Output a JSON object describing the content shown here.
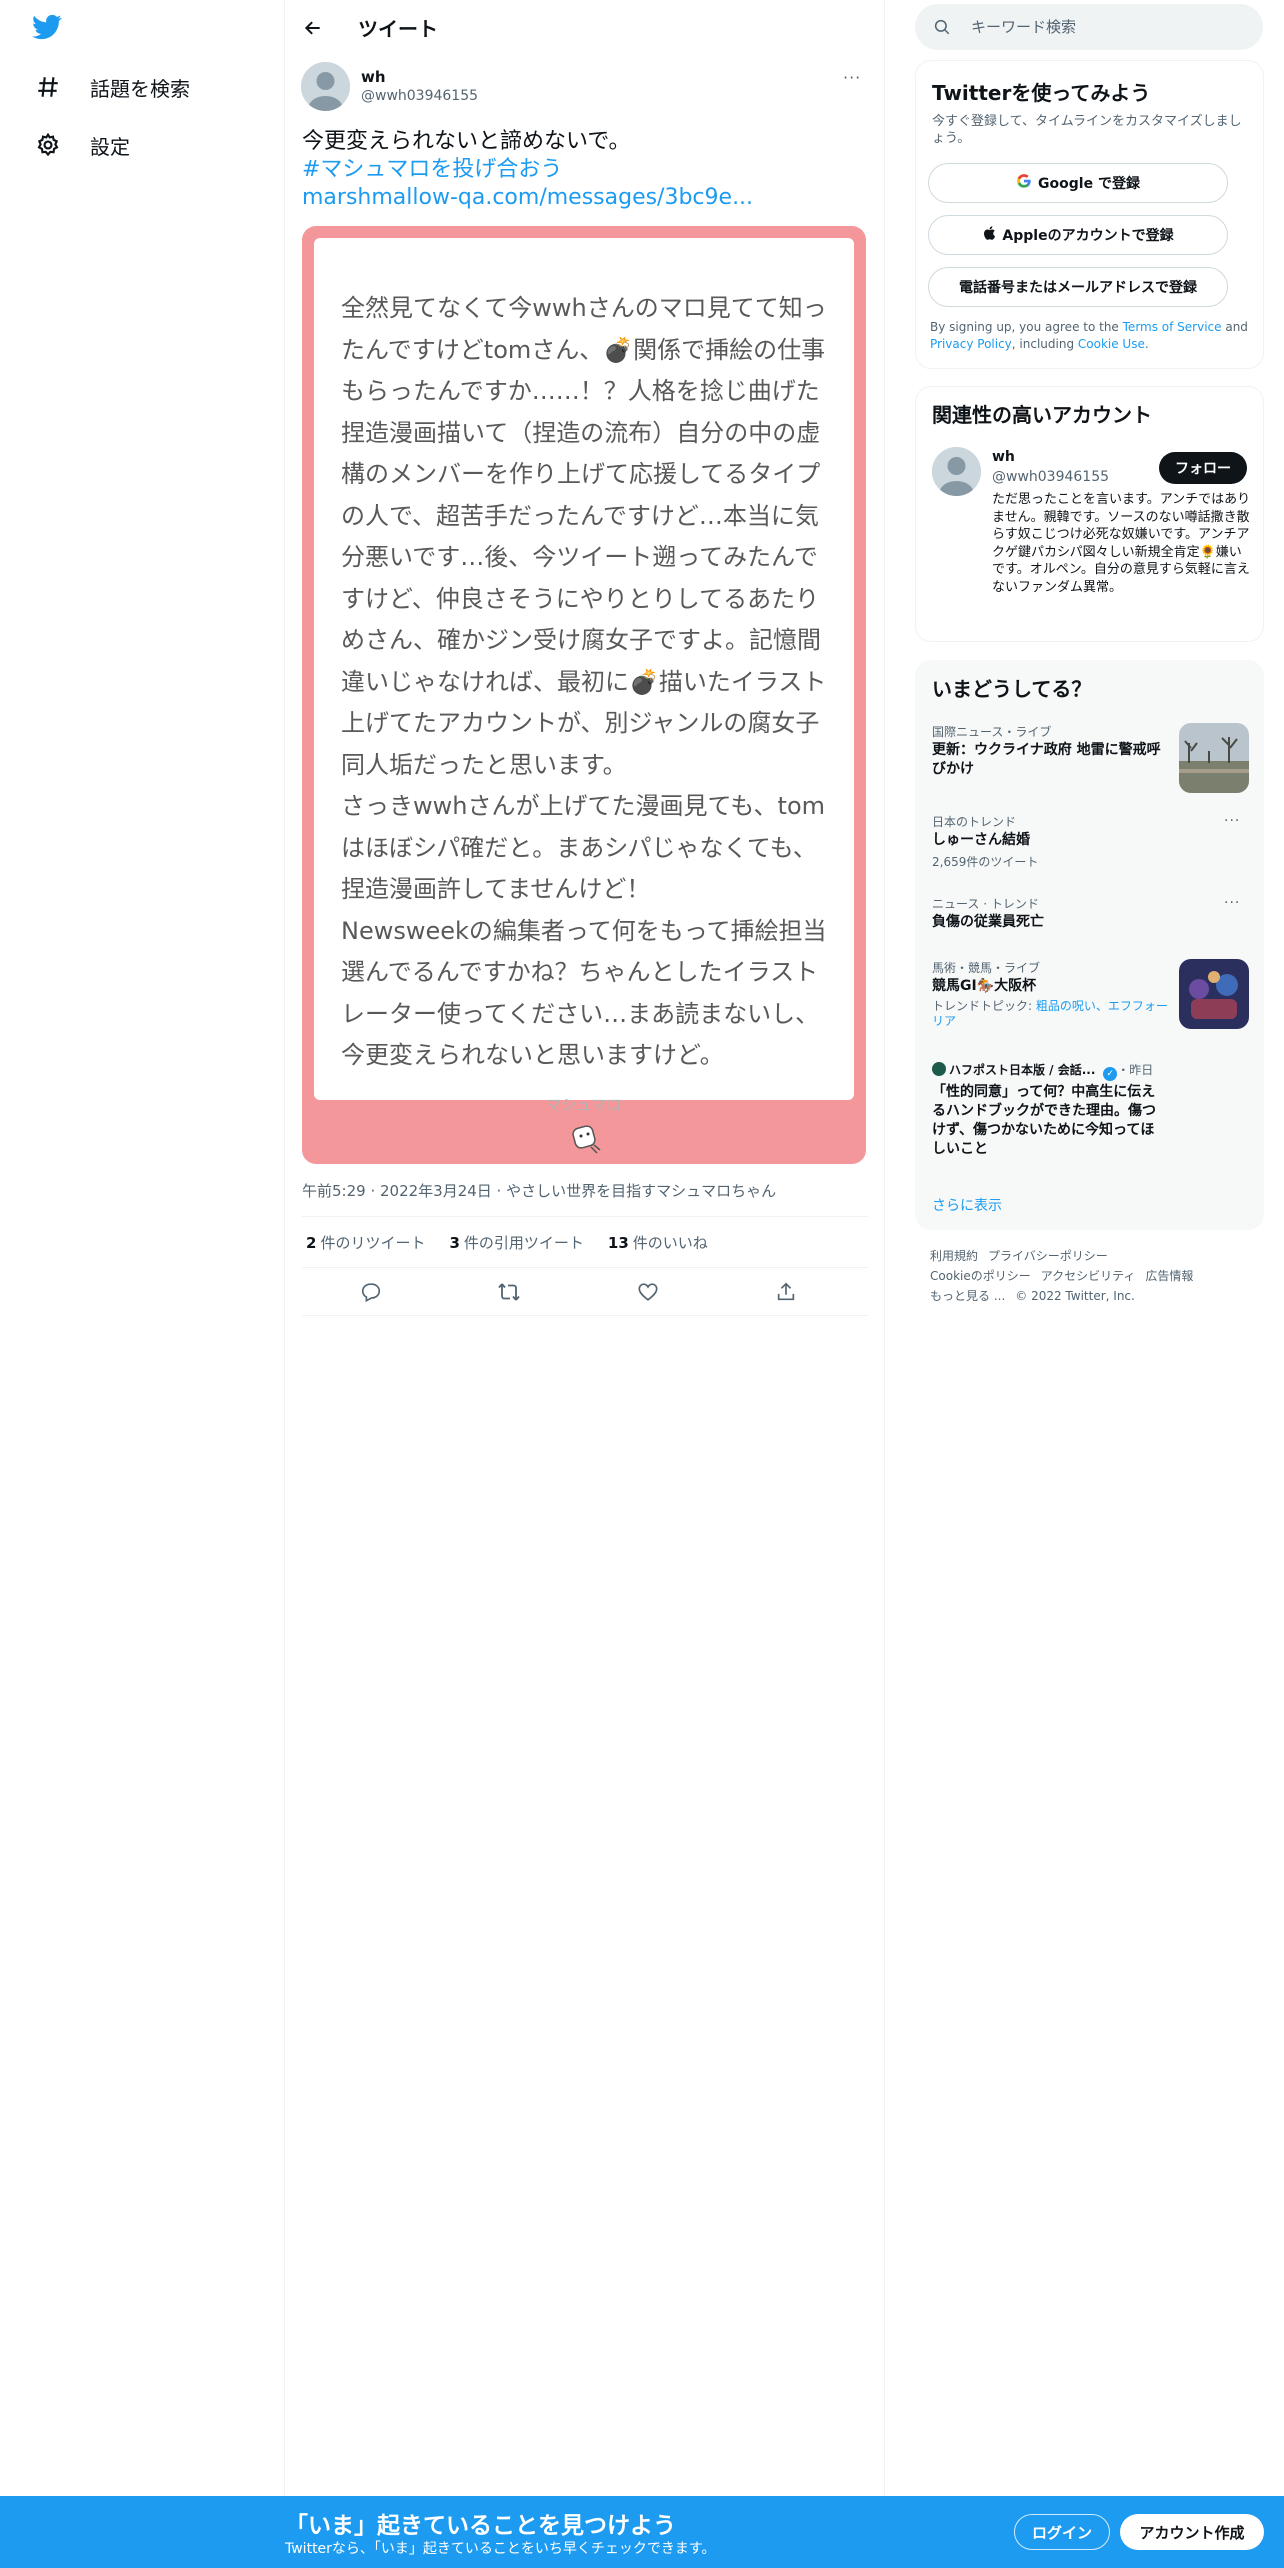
{
  "nav": {
    "items": [
      {
        "label": "話題を検索",
        "icon": "hashtag-icon"
      },
      {
        "label": "設定",
        "icon": "gear-icon"
      }
    ]
  },
  "header": {
    "title": "ツイート"
  },
  "tweet": {
    "name": "wh",
    "handle": "@wwh03946155",
    "more": "···",
    "text": "今更変えられないと諦めないで。",
    "hashtag": "#マシュマロを投げ合おう",
    "link": "marshmallow-qa.com/messages/3bc9e...",
    "card": {
      "text": "全然見てなくて今wwhさんのマロ見てて知ったんですけどtomさん、💣関係で挿絵の仕事もらったんですか……！？人格を捻じ曲げた捏造漫画描いて（捏造の流布）自分の中の虚構のメンバーを作り上げて応援してるタイプの人で、超苦手だったんですけど…本当に気分悪いです…後、今ツイート遡ってみたんですけど、仲良さそうにやりとりしてるあたりめさん、確かジン受け腐女子ですよ。記憶間違いじゃなければ、最初に💣描いたイラスト上げてたアカウントが、別ジャンルの腐女子同人垢だったと思います。\nさっきwwhさんが上げてた漫画見ても、tomはほぼシパ確だと。まあシパじゃなくても、捏造漫画許してませんけど！\nNewsweekの編集者って何をもって挿絵担当選んでるんですかね？ちゃんとしたイラストレーター使ってください…まあ読まないし、今更変えられないと思いますけど。",
      "footer": "マシュマロ"
    },
    "meta": "午前5:29 · 2022年3月24日 · やさしい世界を目指すマシュマロちゃん",
    "stats": {
      "retweets_num": "2",
      "retweets_label": "件のリツイート",
      "quotes_num": "3",
      "quotes_label": "件の引用ツイート",
      "likes_num": "13",
      "likes_label": "件のいいね"
    }
  },
  "search": {
    "placeholder": "キーワード検索"
  },
  "signup_panel": {
    "title": "Twitterを使ってみよう",
    "subtitle": "今すぐ登録して、タイムラインをカスタマイズしましょう。",
    "google": "Google で登録",
    "apple": "Appleのアカウントで登録",
    "phone": "電話番号またはメールアドレスで登録",
    "fine_pre": "By signing up, you agree to the ",
    "tos": "Terms of Service",
    "fine_mid": " and ",
    "privacy": "Privacy Policy",
    "fine_mid2": ", including ",
    "cookie": "Cookie Use",
    "fine_end": "."
  },
  "related": {
    "title": "関連性の高いアカウント",
    "name": "wh",
    "handle": "@wwh03946155",
    "follow": "フォロー",
    "bio": "ただ思ったことを言います。アンチではありません。親韓です。ソースのない噂話撒き散らす奴こじつけ必死な奴嫌いです。アンチアクゲ鍵パカシパ図々しい新規全肯定🌻嫌いです。オルペン。自分の意見すら気軽に言えないファンダム異常。"
  },
  "trends": {
    "title": "いまどうしてる？",
    "items": [
      {
        "context": "国際ニュース・ライブ",
        "title": "更新：ウクライナ政府 地雷に警戒呼びかけ"
      },
      {
        "context": "日本のトレンド",
        "title": "しゅーさん結婚",
        "count": "2,659件のツイート"
      },
      {
        "context": "ニュース · トレンド",
        "title": "負傷の従業員死亡"
      },
      {
        "context": "馬術・競馬・ライブ",
        "title": "競馬GⅠ🏇大阪杯",
        "topic_pre": "トレンドトピック: ",
        "topic_links": "粗品の呪い、エフフォーリア"
      },
      {
        "context": "ハフポスト日本版 / 会話...",
        "time": "・昨日",
        "title": "「性的同意」って何？中高生に伝えるハンドブックができた理由。傷つけず、傷つかないために今知ってほしいこと"
      }
    ],
    "more": "さらに表示"
  },
  "footer": {
    "links": [
      "利用規約",
      "プライバシーポリシー",
      "Cookieのポリシー",
      "アクセシビリティ",
      "広告情報",
      "もっと見る ..."
    ],
    "copyright": "© 2022 Twitter, Inc."
  },
  "bottom": {
    "title": "「いま」起きていることを見つけよう",
    "subtitle": "Twitterなら、「いま」起きていることをいち早くチェックできます。",
    "login": "ログイン",
    "signup": "アカウント作成"
  },
  "colors": {
    "accent": "#1d9bf0",
    "card_border": "#f3979a",
    "text": "#0f1419",
    "muted": "#536471"
  }
}
